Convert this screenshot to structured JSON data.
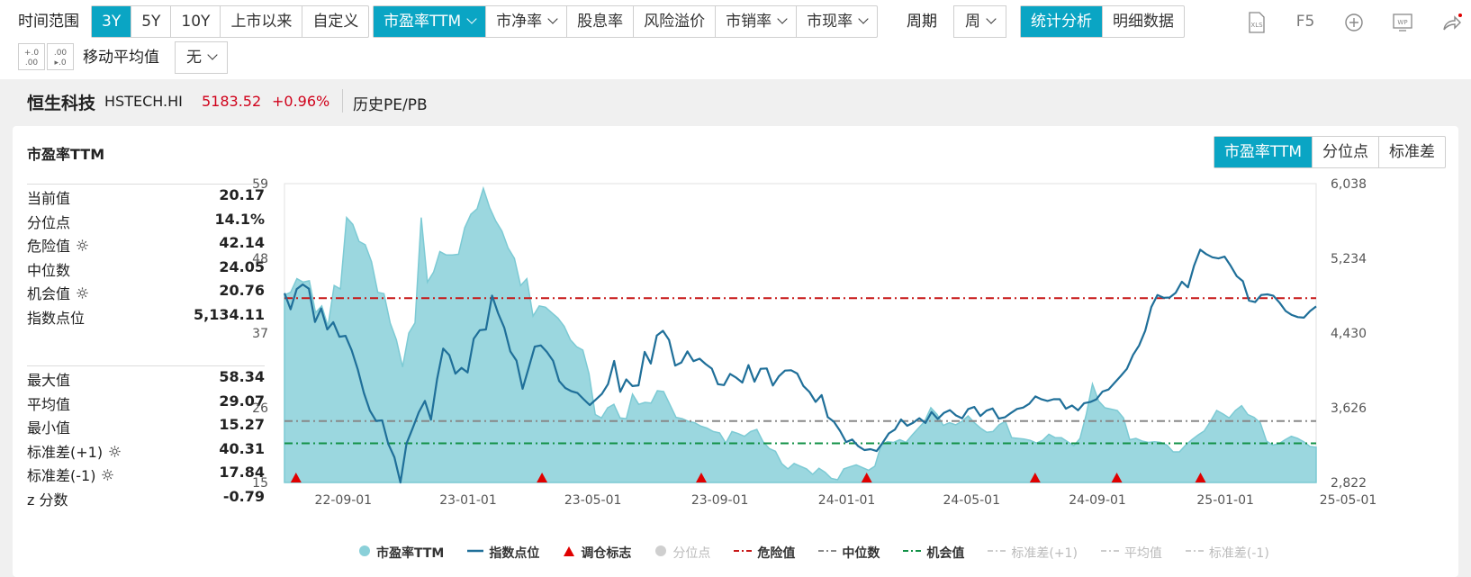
{
  "toolbar": {
    "time_range_label": "时间范围",
    "time_options": [
      "3Y",
      "5Y",
      "10Y",
      "上市以来",
      "自定义"
    ],
    "time_active": 0,
    "metric_options": [
      {
        "label": "市盈率TTM",
        "dropdown": true
      },
      {
        "label": "市净率",
        "dropdown": true
      },
      {
        "label": "股息率",
        "dropdown": false
      },
      {
        "label": "风险溢价",
        "dropdown": false
      },
      {
        "label": "市销率",
        "dropdown": true
      },
      {
        "label": "市现率",
        "dropdown": true
      }
    ],
    "metric_active": 0,
    "period_label": "周期",
    "period_value": "周",
    "view_options": [
      "统计分析",
      "明细数据"
    ],
    "view_active": 0,
    "ma_label": "移动平均值",
    "ma_value": "无",
    "tools": [
      "xls-icon",
      "F5",
      "add-icon",
      "wp-icon",
      "share-icon"
    ],
    "f5_label": "F5"
  },
  "titlebar": {
    "name": "恒生科技",
    "code": "HSTECH.HI",
    "price": "5183.52",
    "change": "+0.96%",
    "tab": "历史PE/PB"
  },
  "panel": {
    "title": "市盈率TTM",
    "mode_options": [
      "市盈率TTM",
      "分位点",
      "标准差"
    ],
    "mode_active": 0
  },
  "stats_top": [
    {
      "k": "当前值",
      "v": "20.17",
      "gear": false
    },
    {
      "k": "分位点",
      "v": "14.1%",
      "gear": false
    },
    {
      "k": "危险值",
      "v": "42.14",
      "gear": true
    },
    {
      "k": "中位数",
      "v": "24.05",
      "gear": false
    },
    {
      "k": "机会值",
      "v": "20.76",
      "gear": true
    },
    {
      "k": "指数点位",
      "v": "5,134.11",
      "gear": false
    }
  ],
  "stats_bottom": [
    {
      "k": "最大值",
      "v": "58.34",
      "gear": false
    },
    {
      "k": "平均值",
      "v": "29.07",
      "gear": false
    },
    {
      "k": "最小值",
      "v": "15.27",
      "gear": false
    },
    {
      "k": "标准差(+1)",
      "v": "40.31",
      "gear": true
    },
    {
      "k": "标准差(-1)",
      "v": "17.84",
      "gear": true
    },
    {
      "k": "z 分数",
      "v": "-0.79",
      "gear": false
    }
  ],
  "colors": {
    "accent": "#0aa5c4",
    "area": "#8ad0d9",
    "index_line": "#1f6f99",
    "danger": "#c71818",
    "median": "#888888",
    "opportunity": "#139147",
    "price_red": "#d0021b",
    "marker": "#e00000"
  },
  "chart_data": {
    "type": "area",
    "x_ticks": [
      "22-09-01",
      "23-01-01",
      "23-05-01",
      "23-09-01",
      "24-01-01",
      "24-05-01",
      "24-09-01",
      "25-01-01",
      "25-05-01"
    ],
    "x_tick_pos": [
      0.057,
      0.178,
      0.299,
      0.422,
      0.545,
      0.666,
      0.788,
      0.912,
      1.031
    ],
    "y_left": {
      "ticks": [
        15,
        26,
        37,
        48,
        59
      ],
      "ylim": [
        15,
        59
      ]
    },
    "y_right": {
      "ticks": [
        "2,822",
        "3,626",
        "4,430",
        "5,234",
        "6,038"
      ],
      "ylim": [
        2822,
        6038
      ]
    },
    "series": [
      {
        "name": "市盈率TTM",
        "axis": "left",
        "kind": "area",
        "values": [
          42.6,
          43,
          45,
          44.5,
          44.7,
          40,
          41,
          38,
          44,
          43.5,
          54,
          53,
          50.5,
          50,
          47.5,
          43,
          42.8,
          38.5,
          36,
          32,
          37,
          38.5,
          54,
          44.5,
          46,
          49,
          48.5,
          48.5,
          48.6,
          52.5,
          54.5,
          55.3,
          58.3,
          55.5,
          53.5,
          52,
          49.5,
          48,
          44,
          45,
          39.5,
          41,
          40.8,
          40,
          39.2,
          38,
          36,
          35,
          34.5,
          31,
          25,
          24.5,
          26,
          26.5,
          24.5,
          24.4,
          28,
          26.5,
          26.8,
          26.7,
          28.5,
          28.4,
          26.5,
          24.6,
          24.4,
          24,
          23.8,
          23.3,
          23,
          22.5,
          22.3,
          20.8,
          22.5,
          22.2,
          21.8,
          22.5,
          22.8,
          21,
          20,
          19.6,
          17.8,
          17,
          17.8,
          17.4,
          17,
          16.2,
          17.1,
          16.5,
          15.6,
          15.4,
          17,
          17.3,
          17.6,
          17.2,
          16.8,
          17.4,
          20.5,
          21,
          20.9,
          21.3,
          20.9,
          22,
          23,
          24,
          26,
          25,
          23.4,
          23.8,
          23.5,
          24,
          24.8,
          23.8,
          23,
          22.4,
          22.5,
          23.5,
          24,
          21.6,
          21.5,
          21.4,
          21.2,
          20.8,
          21.2,
          22.1,
          21.6,
          21.6,
          21,
          20.4,
          21.5,
          25,
          29.5,
          27,
          26,
          25.8,
          25.6,
          24.5,
          21.3,
          21.5,
          21.1,
          20.9,
          21,
          20.9,
          20.5,
          19.5,
          19.5,
          20.5,
          21.3,
          22,
          22.6,
          24,
          25.6,
          25.1,
          24.5,
          25.6,
          26.3,
          25,
          24.6,
          23.8,
          21.1,
          20.5,
          20.7,
          21.3,
          21.8,
          21.5,
          21,
          20.3,
          20.2
        ]
      },
      {
        "name": "指数点位",
        "axis": "right",
        "kind": "line",
        "values": [
          4859,
          4686,
          4904,
          4953,
          4908,
          4549,
          4693,
          4469,
          4547,
          4390,
          4400,
          4245,
          4040,
          3786,
          3595,
          3485,
          3490,
          3238,
          3093,
          2822,
          3241,
          3406,
          3578,
          3700,
          3497,
          3932,
          4263,
          4193,
          3993,
          4055,
          4006,
          4368,
          4461,
          4469,
          4833,
          4643,
          4489,
          4232,
          4134,
          3830,
          4053,
          4284,
          4297,
          4226,
          4131,
          3914,
          3839,
          3804,
          3785,
          3718,
          3655,
          3714,
          3775,
          3881,
          4130,
          3797,
          3931,
          3859,
          3867,
          4228,
          4102,
          4404,
          4454,
          4355,
          4080,
          4112,
          4232,
          4128,
          4154,
          4096,
          4047,
          3880,
          3870,
          3990,
          3950,
          3897,
          4085,
          3907,
          4045,
          4049,
          3865,
          3966,
          4026,
          4030,
          3994,
          3860,
          3796,
          3689,
          3763,
          3525,
          3476,
          3378,
          3257,
          3284,
          3212,
          3171,
          3180,
          3160,
          3249,
          3350,
          3392,
          3500,
          3432,
          3465,
          3514,
          3462,
          3580,
          3506,
          3570,
          3601,
          3544,
          3512,
          3612,
          3635,
          3537,
          3595,
          3618,
          3510,
          3523,
          3570,
          3613,
          3628,
          3669,
          3748,
          3717,
          3700,
          3718,
          3718,
          3616,
          3650,
          3599,
          3675,
          3688,
          3717,
          3800,
          3823,
          3896,
          3969,
          4045,
          4195,
          4296,
          4454,
          4710,
          4839,
          4810,
          4813,
          4864,
          4982,
          4922,
          5156,
          5327,
          5280,
          5246,
          5233,
          5252,
          5153,
          5042,
          4988,
          4780,
          4763,
          4840,
          4847,
          4831,
          4757,
          4667,
          4625,
          4601,
          4596,
          4666,
          4717
        ]
      },
      {
        "name": "危险值",
        "axis": "left",
        "kind": "hline",
        "value": 42.14
      },
      {
        "name": "中位数",
        "axis": "left",
        "kind": "hline",
        "value": 24.05
      },
      {
        "name": "机会值",
        "axis": "left",
        "kind": "hline",
        "value": 20.76
      }
    ],
    "markers": {
      "name": "调仓标志",
      "positions": [
        0.006,
        0.247,
        0.403,
        0.565,
        0.73,
        0.81,
        0.892
      ]
    },
    "legend": [
      {
        "name": "市盈率TTM",
        "symbol": "dot",
        "color": "#8ad0d9",
        "enabled": true
      },
      {
        "name": "指数点位",
        "symbol": "line",
        "color": "#1f6f99",
        "enabled": true
      },
      {
        "name": "调仓标志",
        "symbol": "triangle",
        "color": "#e00000",
        "enabled": true
      },
      {
        "name": "分位点",
        "symbol": "dot",
        "color": "#cfcfcf",
        "enabled": false
      },
      {
        "name": "危险值",
        "symbol": "dash",
        "color": "#c71818",
        "enabled": true
      },
      {
        "name": "中位数",
        "symbol": "dash",
        "color": "#888888",
        "enabled": true
      },
      {
        "name": "机会值",
        "symbol": "dash",
        "color": "#139147",
        "enabled": true
      },
      {
        "name": "标准差(+1)",
        "symbol": "dash",
        "color": "#cccccc",
        "enabled": false
      },
      {
        "name": "平均值",
        "symbol": "dash",
        "color": "#cccccc",
        "enabled": false
      },
      {
        "name": "标准差(-1)",
        "symbol": "dash",
        "color": "#cccccc",
        "enabled": false
      }
    ],
    "legend_position": "bottom",
    "grid": true
  }
}
